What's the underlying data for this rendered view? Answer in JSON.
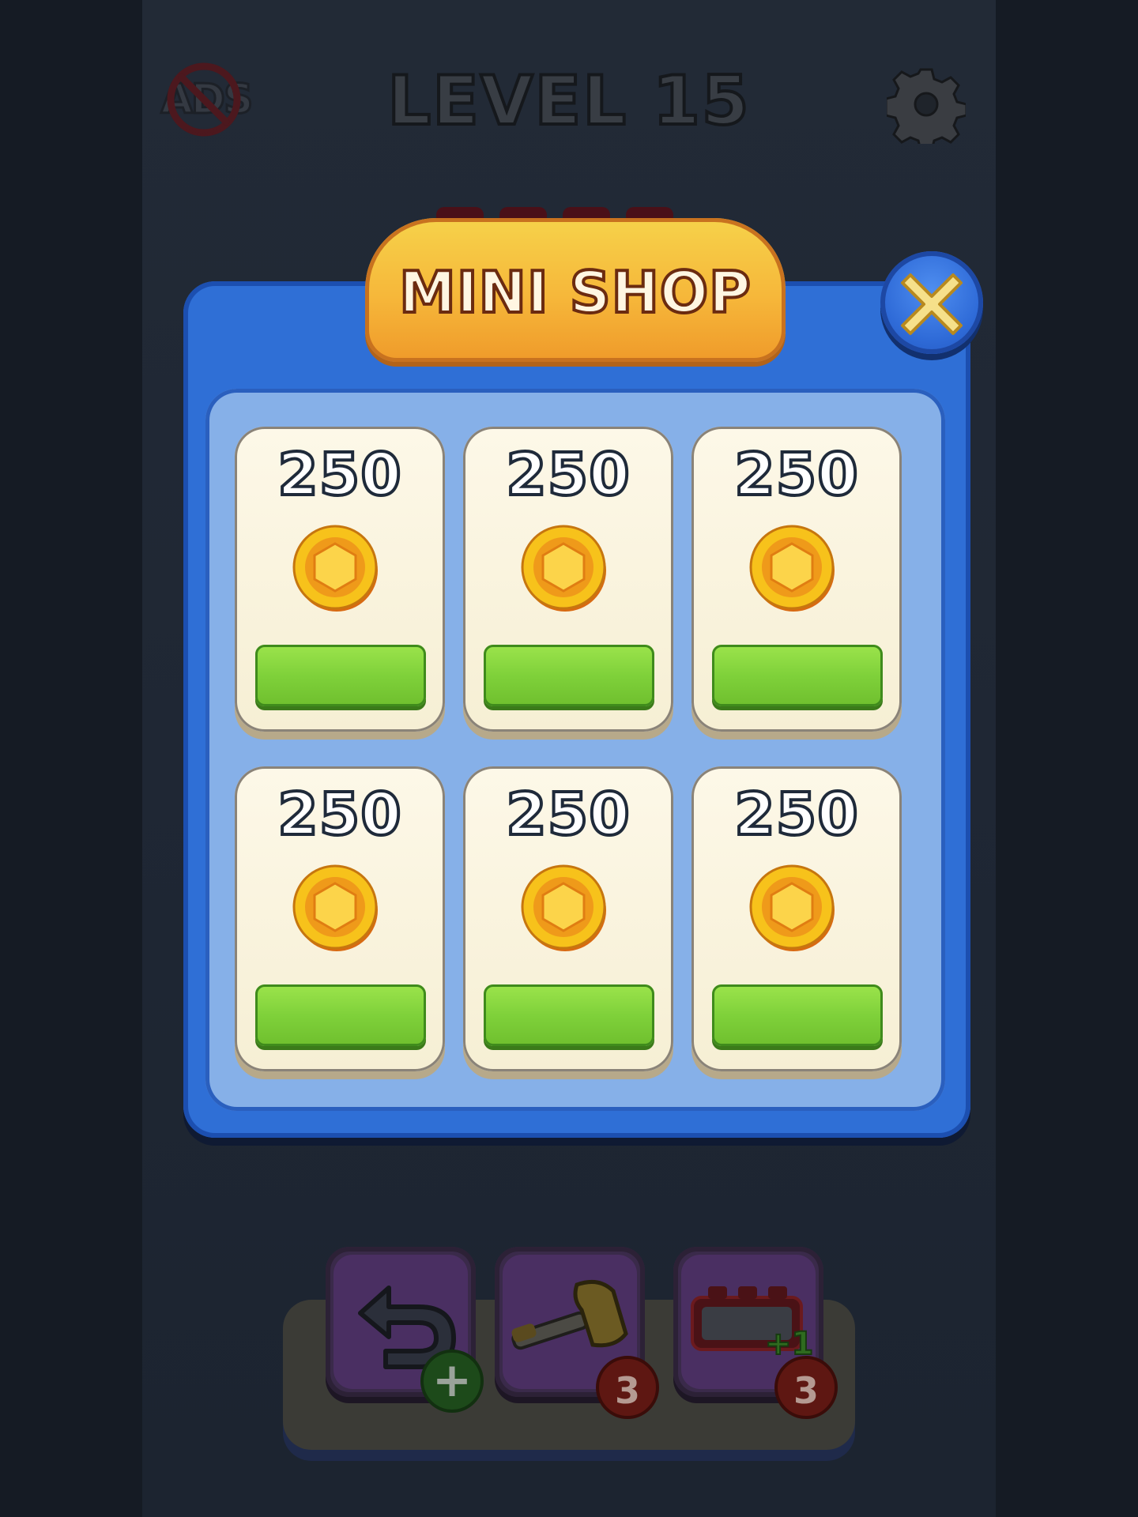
{
  "header": {
    "level_title": "LEVEL 15",
    "no_ads_label": "ADS",
    "settings_icon": "gear-icon"
  },
  "modal": {
    "title": "MINI SHOP",
    "close_icon": "close-icon",
    "items": [
      {
        "amount": "250",
        "icon": "coin-icon"
      },
      {
        "amount": "250",
        "icon": "coin-icon"
      },
      {
        "amount": "250",
        "icon": "coin-icon"
      },
      {
        "amount": "250",
        "icon": "coin-icon"
      },
      {
        "amount": "250",
        "icon": "coin-icon"
      },
      {
        "amount": "250",
        "icon": "coin-icon"
      }
    ]
  },
  "boosters": [
    {
      "name": "undo",
      "icon": "undo-icon",
      "badge": "+"
    },
    {
      "name": "hammer",
      "icon": "hammer-icon",
      "badge": "3"
    },
    {
      "name": "extra-slot",
      "icon": "extra-slot-icon",
      "overlay": "+1",
      "badge": "3"
    }
  ],
  "colors": {
    "modal_blue": "#2f6fd6",
    "banner_orange": "#f6b73a",
    "buy_green": "#7fd13a",
    "card_cream": "#fbf5e0"
  }
}
